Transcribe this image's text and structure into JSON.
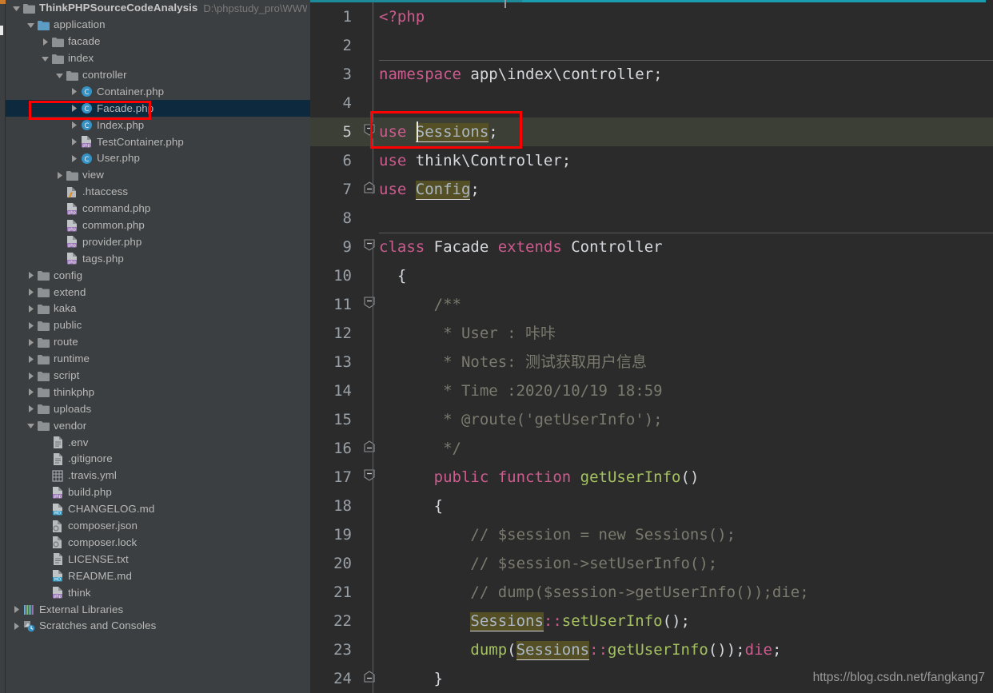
{
  "window": {
    "background_color": "#2b2b2b",
    "sidebar_color": "#3c3f41",
    "accent_color": "#199cb0",
    "highlight_color": "#554f26",
    "current_line_color": "#3c3f35",
    "selection_color": "#0d293e",
    "annotation_color": "#ff0000"
  },
  "sidebar": {
    "project_root_label": "ThinkPHPSourceCodeAnalysis",
    "project_root_path": "D:\\phpstudy_pro\\WWW\\Th",
    "items": [
      {
        "label": "ThinkPHPSourceCodeAnalysis",
        "indent": 0,
        "arrow": "down",
        "icon": "folder-icon",
        "root": true
      },
      {
        "label": "application",
        "indent": 1,
        "arrow": "down",
        "icon": "folder-blue-icon"
      },
      {
        "label": "facade",
        "indent": 2,
        "arrow": "right",
        "icon": "folder-icon"
      },
      {
        "label": "index",
        "indent": 2,
        "arrow": "down",
        "icon": "folder-icon"
      },
      {
        "label": "controller",
        "indent": 3,
        "arrow": "down",
        "icon": "folder-icon"
      },
      {
        "label": "Container.php",
        "indent": 4,
        "arrow": "right",
        "icon": "php-class-icon"
      },
      {
        "label": "Facade.php",
        "indent": 4,
        "arrow": "right",
        "icon": "php-class-icon",
        "selected": true,
        "annotated": true
      },
      {
        "label": "Index.php",
        "indent": 4,
        "arrow": "right",
        "icon": "php-class-icon"
      },
      {
        "label": "TestContainer.php",
        "indent": 4,
        "arrow": "right",
        "icon": "php-file-icon"
      },
      {
        "label": "User.php",
        "indent": 4,
        "arrow": "right",
        "icon": "php-class-icon"
      },
      {
        "label": "view",
        "indent": 3,
        "arrow": "right",
        "icon": "folder-icon"
      },
      {
        "label": ".htaccess",
        "indent": 3,
        "arrow": "none",
        "icon": "htaccess-icon"
      },
      {
        "label": "command.php",
        "indent": 3,
        "arrow": "none",
        "icon": "php-file-icon"
      },
      {
        "label": "common.php",
        "indent": 3,
        "arrow": "none",
        "icon": "php-file-icon"
      },
      {
        "label": "provider.php",
        "indent": 3,
        "arrow": "none",
        "icon": "php-file-icon"
      },
      {
        "label": "tags.php",
        "indent": 3,
        "arrow": "none",
        "icon": "php-file-icon"
      },
      {
        "label": "config",
        "indent": 1,
        "arrow": "right",
        "icon": "folder-icon"
      },
      {
        "label": "extend",
        "indent": 1,
        "arrow": "right",
        "icon": "folder-icon"
      },
      {
        "label": "kaka",
        "indent": 1,
        "arrow": "right",
        "icon": "folder-icon"
      },
      {
        "label": "public",
        "indent": 1,
        "arrow": "right",
        "icon": "folder-icon"
      },
      {
        "label": "route",
        "indent": 1,
        "arrow": "right",
        "icon": "folder-icon"
      },
      {
        "label": "runtime",
        "indent": 1,
        "arrow": "right",
        "icon": "folder-icon"
      },
      {
        "label": "script",
        "indent": 1,
        "arrow": "right",
        "icon": "folder-icon"
      },
      {
        "label": "thinkphp",
        "indent": 1,
        "arrow": "right",
        "icon": "folder-icon"
      },
      {
        "label": "uploads",
        "indent": 1,
        "arrow": "right",
        "icon": "folder-icon"
      },
      {
        "label": "vendor",
        "indent": 1,
        "arrow": "down",
        "icon": "folder-icon"
      },
      {
        "label": ".env",
        "indent": 2,
        "arrow": "none",
        "icon": "text-file-icon"
      },
      {
        "label": ".gitignore",
        "indent": 2,
        "arrow": "none",
        "icon": "text-file-icon"
      },
      {
        "label": ".travis.yml",
        "indent": 2,
        "arrow": "none",
        "icon": "yml-file-icon"
      },
      {
        "label": "build.php",
        "indent": 2,
        "arrow": "none",
        "icon": "php-file-icon"
      },
      {
        "label": "CHANGELOG.md",
        "indent": 2,
        "arrow": "none",
        "icon": "md-file-icon"
      },
      {
        "label": "composer.json",
        "indent": 2,
        "arrow": "none",
        "icon": "composer-icon"
      },
      {
        "label": "composer.lock",
        "indent": 2,
        "arrow": "none",
        "icon": "composer-icon"
      },
      {
        "label": "LICENSE.txt",
        "indent": 2,
        "arrow": "none",
        "icon": "text-file-icon"
      },
      {
        "label": "README.md",
        "indent": 2,
        "arrow": "none",
        "icon": "md-file-icon"
      },
      {
        "label": "think",
        "indent": 2,
        "arrow": "none",
        "icon": "php-file-icon"
      },
      {
        "label": "External Libraries",
        "indent": 0,
        "arrow": "right",
        "icon": "libraries-icon"
      },
      {
        "label": "Scratches and Consoles",
        "indent": 0,
        "arrow": "right",
        "icon": "scratches-icon"
      }
    ]
  },
  "editor": {
    "lines": [
      {
        "num": "1",
        "segments": [
          {
            "t": "<?php",
            "c": "kw"
          }
        ]
      },
      {
        "num": "2",
        "segments": []
      },
      {
        "num": "3",
        "segments": [
          {
            "t": "namespace ",
            "c": "kw"
          },
          {
            "t": "app\\index\\controller;",
            "c": "plain"
          }
        ],
        "separator": true
      },
      {
        "num": "4",
        "segments": []
      },
      {
        "num": "5",
        "segments": [
          {
            "t": "use ",
            "c": "kw"
          },
          {
            "t": "Sessions",
            "c": "hl"
          },
          {
            "t": ";",
            "c": "plain"
          }
        ],
        "current": true,
        "fold": "open",
        "caret": true
      },
      {
        "num": "6",
        "segments": [
          {
            "t": "use ",
            "c": "kw"
          },
          {
            "t": "think\\Controller;",
            "c": "plain"
          }
        ]
      },
      {
        "num": "7",
        "segments": [
          {
            "t": "use ",
            "c": "kw"
          },
          {
            "t": "Config",
            "c": "hl"
          },
          {
            "t": ";",
            "c": "plain"
          }
        ],
        "fold": "close"
      },
      {
        "num": "8",
        "segments": []
      },
      {
        "num": "9",
        "segments": [
          {
            "t": "class ",
            "c": "kw"
          },
          {
            "t": "Facade ",
            "c": "plain"
          },
          {
            "t": "extends ",
            "c": "kw"
          },
          {
            "t": "Controller",
            "c": "plain"
          }
        ],
        "separator": true,
        "fold": "open"
      },
      {
        "num": "10",
        "segments": [
          {
            "t": "  {",
            "c": "plain"
          }
        ]
      },
      {
        "num": "11",
        "segments": [
          {
            "t": "      /**",
            "c": "cmt"
          }
        ],
        "fold": "open"
      },
      {
        "num": "12",
        "segments": [
          {
            "t": "       * User : 咔咔",
            "c": "cmt"
          }
        ]
      },
      {
        "num": "13",
        "segments": [
          {
            "t": "       * Notes: 测试获取用户信息",
            "c": "cmt"
          }
        ]
      },
      {
        "num": "14",
        "segments": [
          {
            "t": "       * Time :2020/10/19 18:59",
            "c": "cmt"
          }
        ]
      },
      {
        "num": "15",
        "segments": [
          {
            "t": "       * @route('getUserInfo');",
            "c": "cmt"
          }
        ]
      },
      {
        "num": "16",
        "segments": [
          {
            "t": "       */",
            "c": "cmt"
          }
        ],
        "fold": "close"
      },
      {
        "num": "17",
        "segments": [
          {
            "t": "      public function ",
            "c": "kw"
          },
          {
            "t": "getUserInfo",
            "c": "fn"
          },
          {
            "t": "()",
            "c": "plain"
          }
        ],
        "fold": "open"
      },
      {
        "num": "18",
        "segments": [
          {
            "t": "      {",
            "c": "plain"
          }
        ]
      },
      {
        "num": "19",
        "segments": [
          {
            "t": "          // $session = new Sessions();",
            "c": "cmt"
          }
        ]
      },
      {
        "num": "20",
        "segments": [
          {
            "t": "          // $session->setUserInfo();",
            "c": "cmt"
          }
        ]
      },
      {
        "num": "21",
        "segments": [
          {
            "t": "          // dump($session->getUserInfo());die;",
            "c": "cmt"
          }
        ]
      },
      {
        "num": "22",
        "segments": [
          {
            "t": "          ",
            "c": "plain"
          },
          {
            "t": "Sessions",
            "c": "hl"
          },
          {
            "t": "::",
            "c": "kw"
          },
          {
            "t": "setUserInfo",
            "c": "fn"
          },
          {
            "t": "();",
            "c": "plain"
          }
        ]
      },
      {
        "num": "23",
        "segments": [
          {
            "t": "          ",
            "c": "plain"
          },
          {
            "t": "dump",
            "c": "fn"
          },
          {
            "t": "(",
            "c": "plain"
          },
          {
            "t": "Sessions",
            "c": "hl"
          },
          {
            "t": "::",
            "c": "kw"
          },
          {
            "t": "getUserInfo",
            "c": "fn"
          },
          {
            "t": "());",
            "c": "plain"
          },
          {
            "t": "die",
            "c": "kw"
          },
          {
            "t": ";",
            "c": "plain"
          }
        ]
      },
      {
        "num": "24",
        "segments": [
          {
            "t": "      }",
            "c": "plain"
          }
        ],
        "fold": "close"
      }
    ]
  },
  "watermark": {
    "text": "https://blog.csdn.net/fangkang7"
  }
}
